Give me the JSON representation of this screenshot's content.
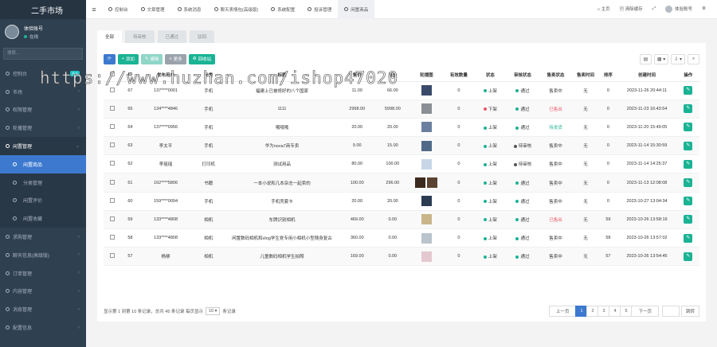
{
  "app": {
    "title": "二手市场",
    "user_name": "体验账号",
    "user_status": "在线",
    "search_placeholder": "搜索..."
  },
  "sidebar": {
    "items": [
      {
        "label": "控制台",
        "badge": "hot",
        "chev": false
      },
      {
        "label": "市场",
        "badge": "",
        "chev": true
      },
      {
        "label": "权限管理",
        "badge": "",
        "chev": true
      },
      {
        "label": "轮播管理",
        "badge": "",
        "chev": true
      },
      {
        "label": "闲置管理",
        "badge": "",
        "chev": true,
        "open": true
      }
    ],
    "sub": [
      {
        "label": "闲置商品",
        "active": true
      },
      {
        "label": "分类管理",
        "active": false
      },
      {
        "label": "闲置评价",
        "active": false
      },
      {
        "label": "闲置收藏",
        "active": false
      }
    ],
    "after": [
      {
        "label": "求购管理"
      },
      {
        "label": "聊天信息(高级版)"
      },
      {
        "label": "订单管理"
      },
      {
        "label": "内容管理"
      },
      {
        "label": "消息管理"
      },
      {
        "label": "配置信息"
      }
    ]
  },
  "topbar": {
    "tabs": [
      {
        "label": "控制台",
        "active": false
      },
      {
        "label": "文章管理",
        "active": false
      },
      {
        "label": "系统消息",
        "active": false
      },
      {
        "label": "聊天表情包(高级版)",
        "active": false
      },
      {
        "label": "系统配置",
        "active": false
      },
      {
        "label": "投诉管理",
        "active": false
      },
      {
        "label": "闲置商品",
        "active": true
      }
    ],
    "home": "主页",
    "clear_cache": "清除缓存",
    "account": "体验账号"
  },
  "page_tabs": [
    "全部",
    "待审核",
    "已通过",
    "驳回"
  ],
  "toolbar": {
    "add": "添加",
    "edit": "编辑",
    "more": "更多",
    "recycle": "回收站"
  },
  "table": {
    "headers": [
      "",
      "ID",
      "发布用户",
      "分类",
      "标题",
      "售价",
      "原价",
      "轮播图",
      "有效数量",
      "状态",
      "审核状态",
      "售卖状态",
      "售卖时间",
      "排序",
      "创建时间",
      "操作"
    ],
    "rows": [
      {
        "id": "67",
        "user": "137****0001",
        "cat": "手机",
        "title": "福建上已被修好的八个国家",
        "price": "11.00",
        "orig": "66.00",
        "thumbs": [
          "#3a4a6a"
        ],
        "qty": "0",
        "status": "上架",
        "sc": "#1ab394",
        "audit": "通过",
        "ac": "#1ab394",
        "sale": "售卖中",
        "time": "无",
        "sort": "0",
        "created": "2023-11-26 20:44:11"
      },
      {
        "id": "65",
        "user": "134****4846",
        "cat": "手机",
        "title": "1111",
        "price": "2998.00",
        "orig": "5998.00",
        "thumbs": [
          "#8a8f95"
        ],
        "qty": "0",
        "status": "下架",
        "sc": "#ed5565",
        "audit": "通过",
        "ac": "#1ab394",
        "sale": "已售出",
        "time": "无",
        "sort": "0",
        "created": "2023-11-23 16:43:54"
      },
      {
        "id": "64",
        "user": "137****0956",
        "cat": "手机",
        "title": "哦哦哦",
        "price": "20.00",
        "orig": "20.00",
        "thumbs": [
          "#6b7fa0"
        ],
        "qty": "0",
        "status": "上架",
        "sc": "#1ab394",
        "audit": "通过",
        "ac": "#1ab394",
        "sale": "待发货",
        "time": "无",
        "sort": "0",
        "created": "2023-11-20 15:49:05"
      },
      {
        "id": "63",
        "user": "李太平",
        "cat": "手机",
        "title": "华为nova7商专卖",
        "price": "9.00",
        "orig": "15.00",
        "thumbs": [
          "#4f6a88"
        ],
        "qty": "0",
        "status": "上架",
        "sc": "#1ab394",
        "audit": "待审核",
        "ac": "#555",
        "sale": "售卖中",
        "time": "无",
        "sort": "0",
        "created": "2023-11-14 15:30:59"
      },
      {
        "id": "62",
        "user": "李瑶瑶",
        "cat": "打印机",
        "title": "测试用品",
        "price": "80.00",
        "orig": "100.00",
        "thumbs": [
          "#c7d6e6"
        ],
        "qty": "0",
        "status": "上架",
        "sc": "#1ab394",
        "audit": "待审核",
        "ac": "#555",
        "sale": "售卖中",
        "time": "无",
        "sort": "0",
        "created": "2023-11-14 14:25:37"
      },
      {
        "id": "61",
        "user": "162****5806",
        "cat": "书籍",
        "title": "一本小说和几本杂志一起卖的",
        "price": "100.00",
        "orig": "296.00",
        "thumbs": [
          "#3b2a1f",
          "#5a4330"
        ],
        "qty": "0",
        "status": "上架",
        "sc": "#1ab394",
        "audit": "通过",
        "ac": "#1ab394",
        "sale": "售卖中",
        "time": "无",
        "sort": "0",
        "created": "2023-11-13 12:08:08"
      },
      {
        "id": "60",
        "user": "159****0094",
        "cat": "手机",
        "title": "手机壳套卡",
        "price": "20.00",
        "orig": "20.00",
        "thumbs": [
          "#2a3b52"
        ],
        "qty": "0",
        "status": "上架",
        "sc": "#1ab394",
        "audit": "通过",
        "ac": "#1ab394",
        "sale": "售卖中",
        "time": "无",
        "sort": "0",
        "created": "2023-10-27 13:04:34"
      },
      {
        "id": "59",
        "user": "133****4808",
        "cat": "相机",
        "title": "车牌识别相机",
        "price": "469.00",
        "orig": "0.00",
        "thumbs": [
          "#c9b58a"
        ],
        "qty": "0",
        "status": "上架",
        "sc": "#1ab394",
        "audit": "通过",
        "ac": "#1ab394",
        "sale": "已售出",
        "time": "无",
        "sort": "59",
        "created": "2023-10-26 13:58:19"
      },
      {
        "id": "58",
        "user": "133****4808",
        "cat": "相机",
        "title": "闲置数码相机和vlog学生党专用小相机小型随身复古",
        "price": "360.00",
        "orig": "0.00",
        "thumbs": [
          "#b9c4cc"
        ],
        "qty": "0",
        "status": "上架",
        "sc": "#1ab394",
        "audit": "通过",
        "ac": "#1ab394",
        "sale": "售卖中",
        "time": "无",
        "sort": "58",
        "created": "2023-10-26 13:57:02"
      },
      {
        "id": "57",
        "user": "杨柳",
        "cat": "相机",
        "title": "儿童数码相机学生拍照",
        "price": "169.00",
        "orig": "0.00",
        "thumbs": [
          "#e4c8d0"
        ],
        "qty": "0",
        "status": "上架",
        "sc": "#1ab394",
        "audit": "通过",
        "ac": "#1ab394",
        "sale": "售卖中",
        "time": "无",
        "sort": "57",
        "created": "2023-10-26 13:54:45"
      }
    ]
  },
  "footer": {
    "summary": "显示第 1 到第 10 条记录，总共 45 条记录 每页显示",
    "page_size": "10",
    "records": "条记录"
  },
  "pager": {
    "prev": "上一页",
    "pages": [
      "1",
      "2",
      "3",
      "4",
      "5"
    ],
    "active": "1",
    "next": "下一页",
    "go": "跳转"
  },
  "watermark": "https://www.huzhan.com/ishop47020"
}
